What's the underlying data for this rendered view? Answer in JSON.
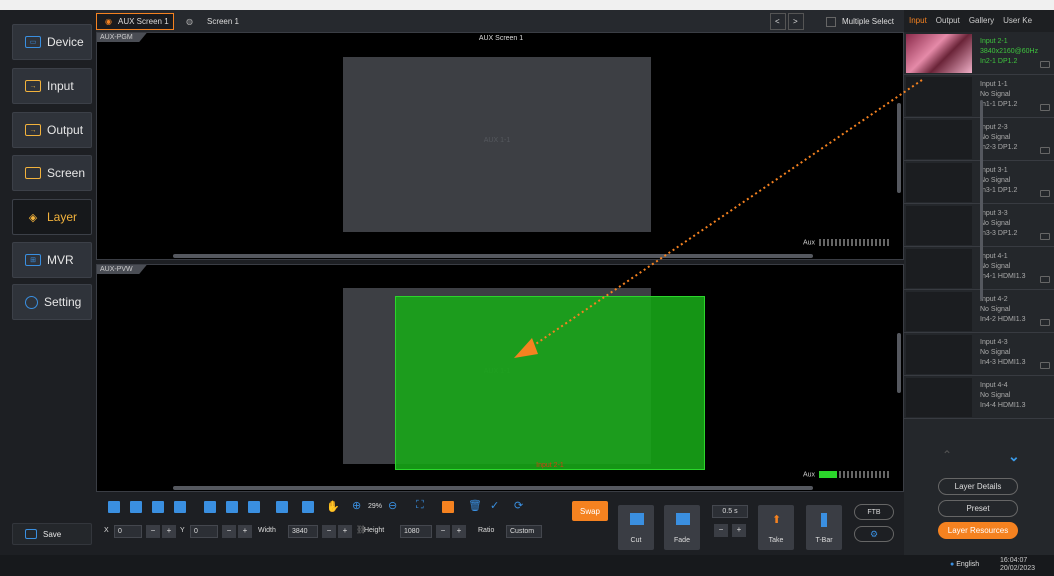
{
  "sidebar": {
    "items": [
      {
        "label": "Device",
        "icon": "device-icon"
      },
      {
        "label": "Input",
        "icon": "input-icon"
      },
      {
        "label": "Output",
        "icon": "output-icon"
      },
      {
        "label": "Screen",
        "icon": "screen-icon"
      },
      {
        "label": "Layer",
        "icon": "layer-icon"
      },
      {
        "label": "MVR",
        "icon": "mvr-icon"
      },
      {
        "label": "Setting",
        "icon": "setting-icon"
      }
    ],
    "save_label": "Save"
  },
  "tabs": {
    "aux": "AUX Screen 1",
    "screen": "Screen 1",
    "multiple_select": "Multiple Select"
  },
  "pgm": {
    "tag": "AUX-PGM",
    "title": "AUX Screen 1",
    "layer_label": "AUX 1-1",
    "aux_label": "Aux"
  },
  "pvw": {
    "tag": "AUX-PVW",
    "layer_label": "AUX 1-1",
    "source_label": "Input 2-1",
    "aux_label": "Aux"
  },
  "right_panel": {
    "tabs": [
      "Input",
      "Output",
      "Gallery",
      "User Ke"
    ],
    "inputs": [
      {
        "name": "Input 2-1",
        "signal": "3840x2160@60Hz",
        "port": "In2-1  DP1.2",
        "active": true
      },
      {
        "name": "Input 1-1",
        "signal": "No Signal",
        "port": "In1-1  DP1.2"
      },
      {
        "name": "Input 2-3",
        "signal": "No Signal",
        "port": "In2-3  DP1.2"
      },
      {
        "name": "Input 3-1",
        "signal": "No Signal",
        "port": "In3-1  DP1.2"
      },
      {
        "name": "Input 3-3",
        "signal": "No Signal",
        "port": "In3-3  DP1.2"
      },
      {
        "name": "Input 4-1",
        "signal": "No Signal",
        "port": "In4-1  HDMI1.3"
      },
      {
        "name": "Input 4-2",
        "signal": "No Signal",
        "port": "In4-2  HDMI1.3"
      },
      {
        "name": "Input 4-3",
        "signal": "No Signal",
        "port": "In4-3  HDMI1.3"
      },
      {
        "name": "Input 4-4",
        "signal": "No Signal",
        "port": "In4-4  HDMI1.3"
      }
    ],
    "buttons": {
      "layer_details": "Layer Details",
      "preset": "Preset",
      "layer_resources": "Layer Resources"
    }
  },
  "toolbar": {
    "zoom": "29%",
    "x_label": "X",
    "x": "0",
    "y_label": "Y",
    "y": "0",
    "width_label": "Width",
    "width": "3840",
    "height_label": "Height",
    "height": "1080",
    "ratio_label": "Ratio",
    "ratio": "Custom",
    "swap": "Swap",
    "cut": "Cut",
    "fade": "Fade",
    "duration": "0.5 s",
    "take": "Take",
    "tbar": "T-Bar",
    "ftb": "FTB"
  },
  "status": {
    "language": "English",
    "time": "16:04:07",
    "date": "20/02/2023"
  },
  "colors": {
    "accent": "#f58220",
    "green_layer": "#18a818",
    "active_text": "#3ec43e"
  }
}
